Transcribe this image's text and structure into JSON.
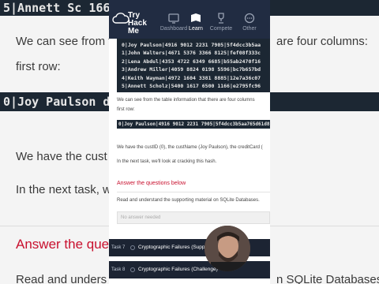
{
  "background": {
    "code_row": "5|Annett Sc                    166|e2795fc96",
    "paragraph_1_a": "We can see from t",
    "paragraph_1_b": "are four columns:",
    "paragraph_1_c": "first row:",
    "code_first_row": "0|Joy Paulson                  dcc3b5aa765d61d8",
    "paragraph_2": "We have the cust                               son), the creditCard (",
    "paragraph_3": "In the next task, w",
    "answer_heading": "Answer the ques",
    "paragraph_4_a": "Read and unders",
    "paragraph_4_b": "n SQLite Databases"
  },
  "nav": {
    "logo_text": "Try Hack Me",
    "items": [
      {
        "label": "Dashboard",
        "icon": "dashboard-icon",
        "active": false
      },
      {
        "label": "Learn",
        "icon": "learn-icon",
        "active": true
      },
      {
        "label": "Compete",
        "icon": "trophy-icon",
        "active": false
      },
      {
        "label": "Other",
        "icon": "more-icon",
        "active": false
      }
    ]
  },
  "content": {
    "table_rows": [
      "0|Joy Paulson|4916 9012 2231 7905|5f4dcc3b5aa",
      "1|John Walters|4671 5376 3366 8125|fef08f333c",
      "2|Lena Abdul|4353 4722 6349 6685|b55ab2470f16",
      "3|Andrew Miller|4059 8824 0198 5596|bc7b657bd",
      "4|Keith Wayman|4972 1604 3381 8885|12e7a36c07",
      "5|Annett Scholz|5400 1617 6500 1166|e2795fc96"
    ],
    "intro_line_1": "We can see from the table information that there are four columns",
    "intro_line_2": "first row:",
    "first_row": "0|Joy Paulson|4916 9012 2231 7905|5f4dcc3b5aa765d61d8",
    "explain_line": "We have the custID (0), the custName (Joy Paulson), the creditCard (",
    "next_task_line": "In the next task, we'll look at cracking this hash.",
    "section_heading": "Answer the questions below",
    "question_text": "Read and understand the supporting material on SQLite Databases.",
    "answer_placeholder": "No answer needed"
  },
  "tasks": [
    {
      "number": "Task 7",
      "title": "Cryptographic Failures (Supporting Material 2)"
    },
    {
      "number": "Task 8",
      "title": "Cryptographic Failures (Challenge)"
    }
  ],
  "colors": {
    "nav_bg": "#212c42",
    "code_bg": "#1c2733",
    "accent_red": "#c8102e",
    "task_bg": "#1c2433"
  }
}
